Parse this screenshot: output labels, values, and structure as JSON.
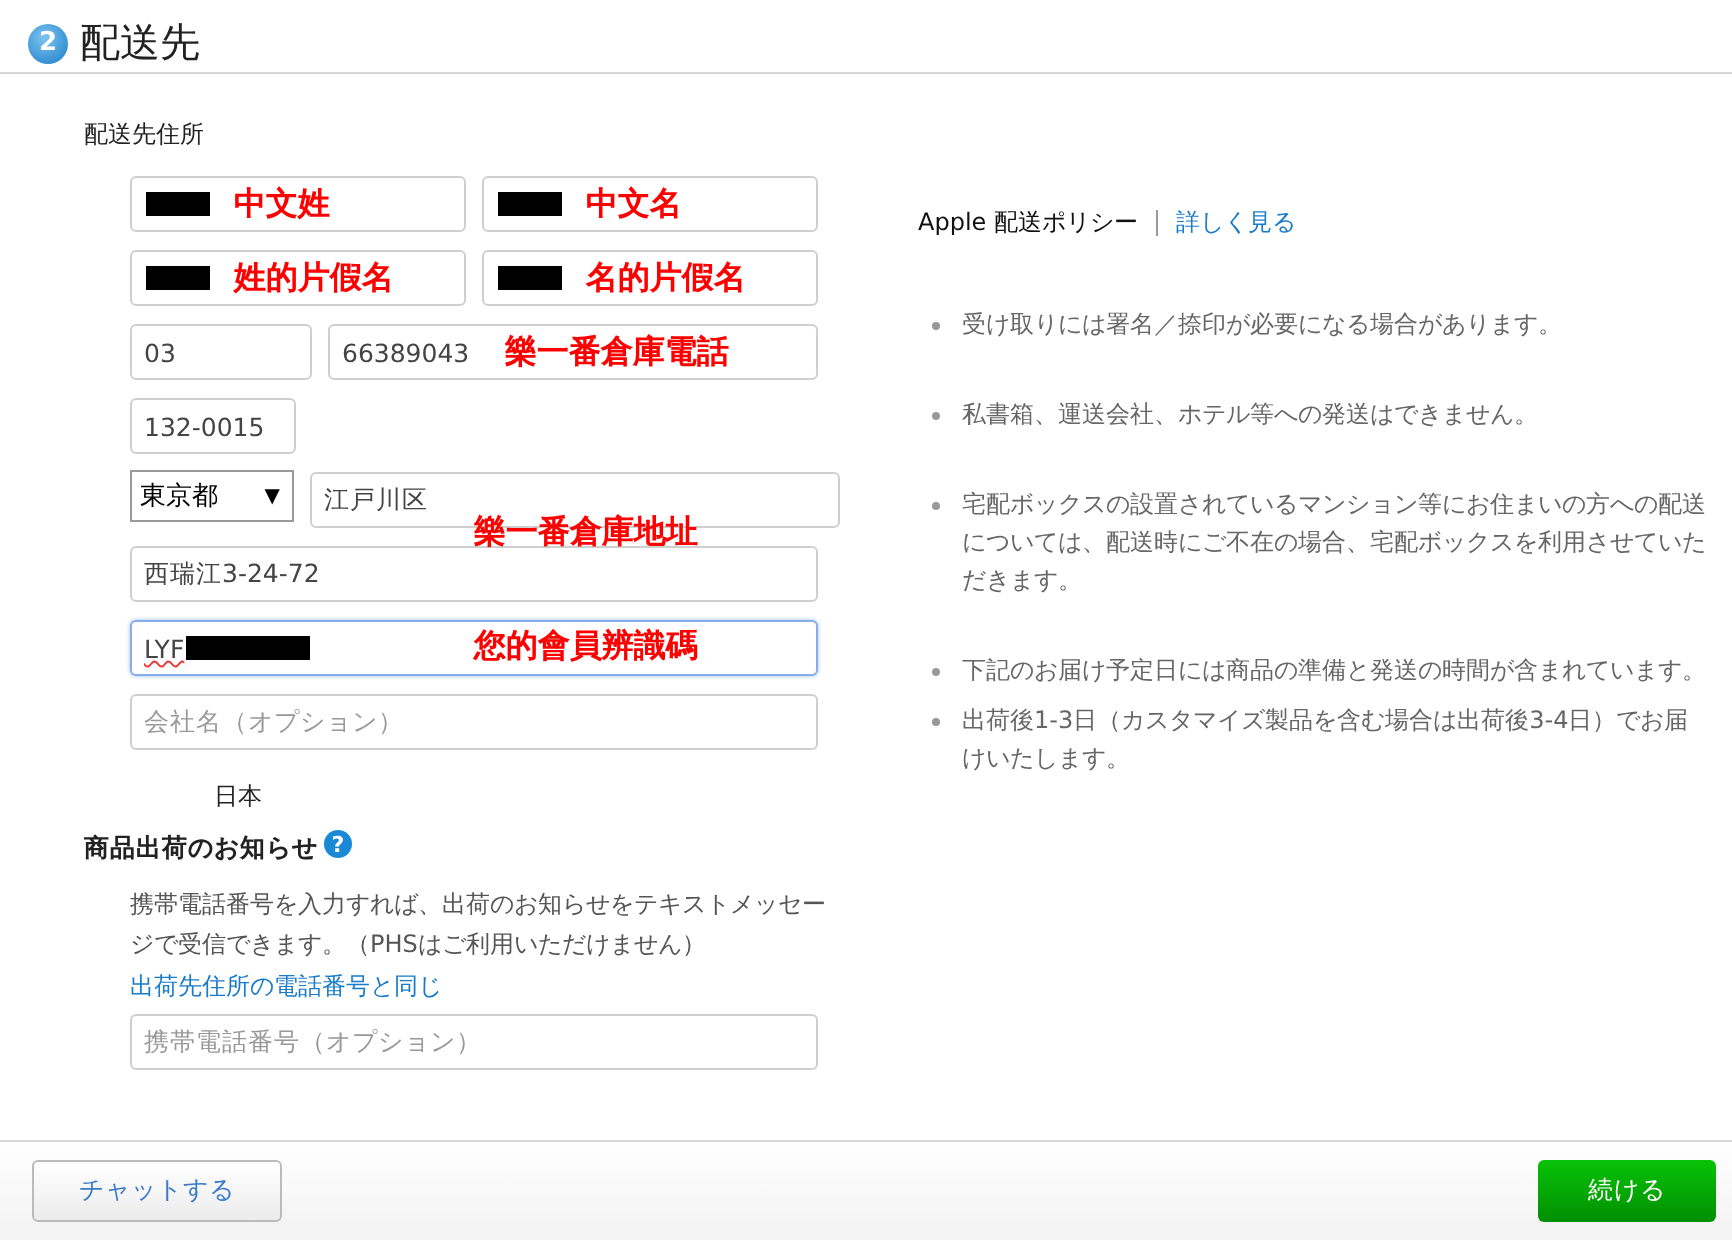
{
  "header": {
    "step": "2",
    "title": "配送先"
  },
  "address": {
    "label": "配送先住所",
    "rows": [
      [
        {
          "kind": "text",
          "redacted": true,
          "annotation": "中文姓"
        },
        {
          "kind": "text",
          "redacted": true,
          "annotation": "中文名"
        }
      ],
      [
        {
          "kind": "text",
          "redacted": true,
          "annotation": "姓的片假名"
        },
        {
          "kind": "text",
          "redacted": true,
          "annotation": "名的片假名"
        }
      ],
      [
        {
          "kind": "text",
          "value": "03"
        },
        {
          "kind": "text",
          "value": "66389043",
          "annotation": "樂一番倉庫電話"
        }
      ],
      [
        {
          "kind": "text",
          "value": "132-0015"
        }
      ],
      [
        {
          "kind": "select",
          "value": "東京都",
          "caret": "▼"
        },
        {
          "kind": "text",
          "value": "江戸川区"
        }
      ],
      [
        {
          "kind": "text",
          "value": "西瑞江3-24-72",
          "annotation": "樂一番倉庫地址"
        }
      ],
      [
        {
          "kind": "text",
          "value": "LYF",
          "redacted": true,
          "misspelled": true,
          "focused": true,
          "annotation": "您的會員辨識碼"
        }
      ],
      [
        {
          "kind": "text",
          "placeholder": "会社名（オプション）"
        }
      ]
    ],
    "country": "日本"
  },
  "notice": {
    "title": "商品出荷のお知らせ",
    "help": "?",
    "description": "携帯電話番号を入力すれば、出荷のお知らせをテキストメッセージで受信できます。（PHSはご利用いただけません）",
    "link": "出荷先住所の電話番号と同じ",
    "field": {
      "placeholder": "携帯電話番号（オプション）"
    }
  },
  "policy": {
    "title": "Apple 配送ポリシー",
    "link": "詳しく見る",
    "items": [
      {
        "text": "受け取りには署名／捺印が必要になる場合があります。"
      },
      {
        "text": "私書箱、運送会社、ホテル等への発送はできません。"
      },
      {
        "text": "宅配ボックスの設置されているマンション等にお住まいの方への配送については、配送時にご不在の場合、宅配ボックスを利用させていただきます。"
      },
      {
        "text": "下記のお届け予定日には商品の準備と発送の時間が含まれています。"
      },
      {
        "text": "出荷後1-3日（カスタマイズ製品を含む場合は出荷後3-4日）でお届けいたします。"
      }
    ]
  },
  "footer": {
    "chat_button": "チャットする",
    "continue_button": "続ける"
  }
}
